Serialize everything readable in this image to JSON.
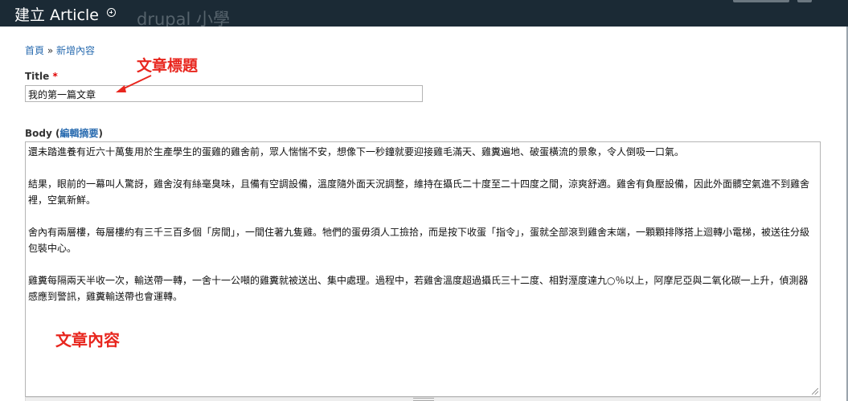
{
  "header": {
    "title": "建立 Article",
    "site_name": "drupal 小學",
    "add_shortcut_icon": "circle-plus-icon"
  },
  "breadcrumb": {
    "home": "首頁",
    "separator": " » ",
    "current": "新增內容"
  },
  "form": {
    "title_label": "Title",
    "required_marker": "*",
    "title_value": "我的第一篇文章",
    "body_label": "Body",
    "body_paren_open": " (",
    "edit_summary_link": "編輯摘要",
    "body_paren_close": ")",
    "body_paragraphs": [
      "還未踏進養有近六十萬隻用於生產學生的蛋雞的雞舍前，眾人惴惴不安，想像下一秒鐘就要迎接雞毛滿天、雞糞遍地、破蛋橫流的景象，令人倒吸一口氣。",
      "結果，眼前的一幕叫人驚訝，雞舍沒有絲毫臭味，且備有空調設備，溫度隨外面天況調整，維持在攝氏二十度至二十四度之間，涼爽舒適。雞舍有負壓設備，因此外面髒空氣進不到雞舍裡，空氣新鮮。",
      "舍內有兩層樓，每層樓約有三千三百多個「房間」，一間住著九隻雞。牠們的蛋毋須人工撿拾，而是按下收蛋「指令」，蛋就全部滾到雞舍末端，一顆顆排隊搭上迴轉小電梯，被送往分級包裝中心。",
      "雞糞每隔兩天半收一次，輸送帶一轉，一舍十一公噸的雞糞就被送出、集中處理。過程中，若雞舍溫度超過攝氏三十二度、相對溼度達九○％以上，阿摩尼亞與二氧化碳一上升，偵測器感應到警訊，雞糞輸送帶也會運轉。"
    ]
  },
  "annotations": {
    "title_note": "文章標題",
    "body_note": "文章內容",
    "color": "#e8261e"
  },
  "colors": {
    "topbar": "#1b2a35",
    "link": "#2a6cb0"
  }
}
